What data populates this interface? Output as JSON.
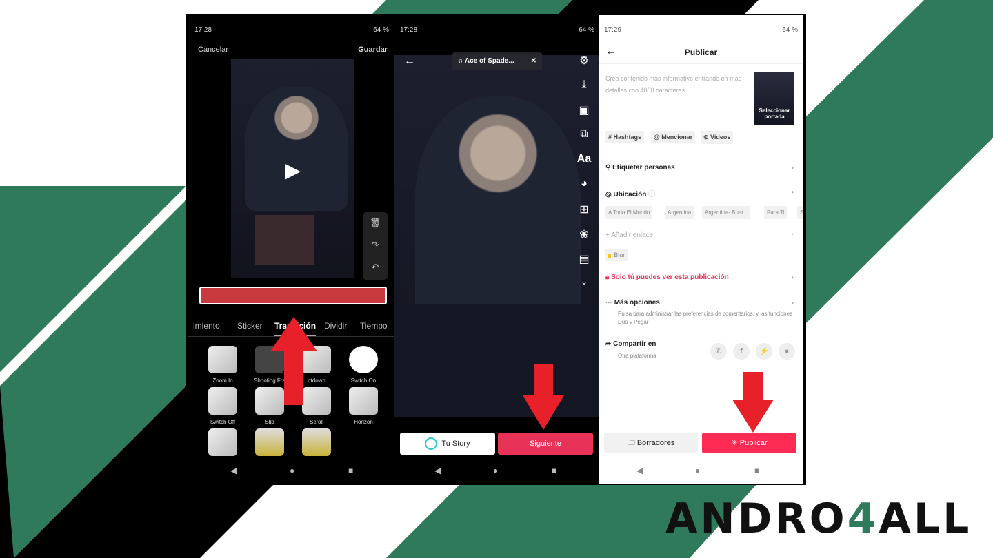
{
  "colors": {
    "green": "#2f7a5a",
    "accent": "#fe2c55",
    "arrow": "#e8202a"
  },
  "editor": {
    "time": "17:28",
    "battery": "64 %",
    "cancel": "Cancelar",
    "save": "Guardar",
    "tabs": [
      "imiento",
      "Sticker",
      "Transición",
      "Dividir",
      "Tiempo"
    ],
    "transitions": [
      "Zoom In",
      "Shooting Fra",
      "ntdown",
      "Switch On",
      "Switch Off",
      "Slip",
      "Scroll",
      "Horizon"
    ]
  },
  "preview": {
    "time": "17:28",
    "battery": "64 %",
    "music": "Ace of Spade...",
    "story_label": "Tu Story",
    "next_label": "Siguiente",
    "tools": [
      "settings-icon",
      "download-icon",
      "clip-icon",
      "cards-icon",
      "text-icon",
      "palette-icon",
      "sticker-icon",
      "effects-icon",
      "captions-icon",
      "chevron-down-icon"
    ],
    "text_tool": "Aa"
  },
  "publish": {
    "time": "17:29",
    "battery": "64 %",
    "title": "Publicar",
    "caption_placeholder": "Crea contenido más informativo entrando en más detalles con 4000 caracteres.",
    "cover_label": "Seleccionar portada",
    "chips": [
      "# Hashtags",
      "@ Mencionar",
      "⊙ Videos"
    ],
    "tag_people": "Etiquetar personas",
    "location": "Ubicación",
    "locations": [
      "A Todo El Mundo",
      "Argentina",
      "Argentina- Buer...",
      "Para Ti",
      "S"
    ],
    "add_link": "Añadir enlace",
    "blur": "Blur",
    "privacy": "Solo tú puedes ver esta publicación",
    "more_options": "Más opciones",
    "more_options_desc": "Pulsa para administrar las preferencias de comentarios, y las funciones Dúo y Pegar",
    "share_on": "Compartir en",
    "share_sub": "Otra plataforma",
    "drafts_label": "Borradores",
    "publish_label": "Publicar"
  },
  "logo": {
    "text_a": "ANDRO",
    "text_b": "4",
    "text_c": "ALL"
  }
}
